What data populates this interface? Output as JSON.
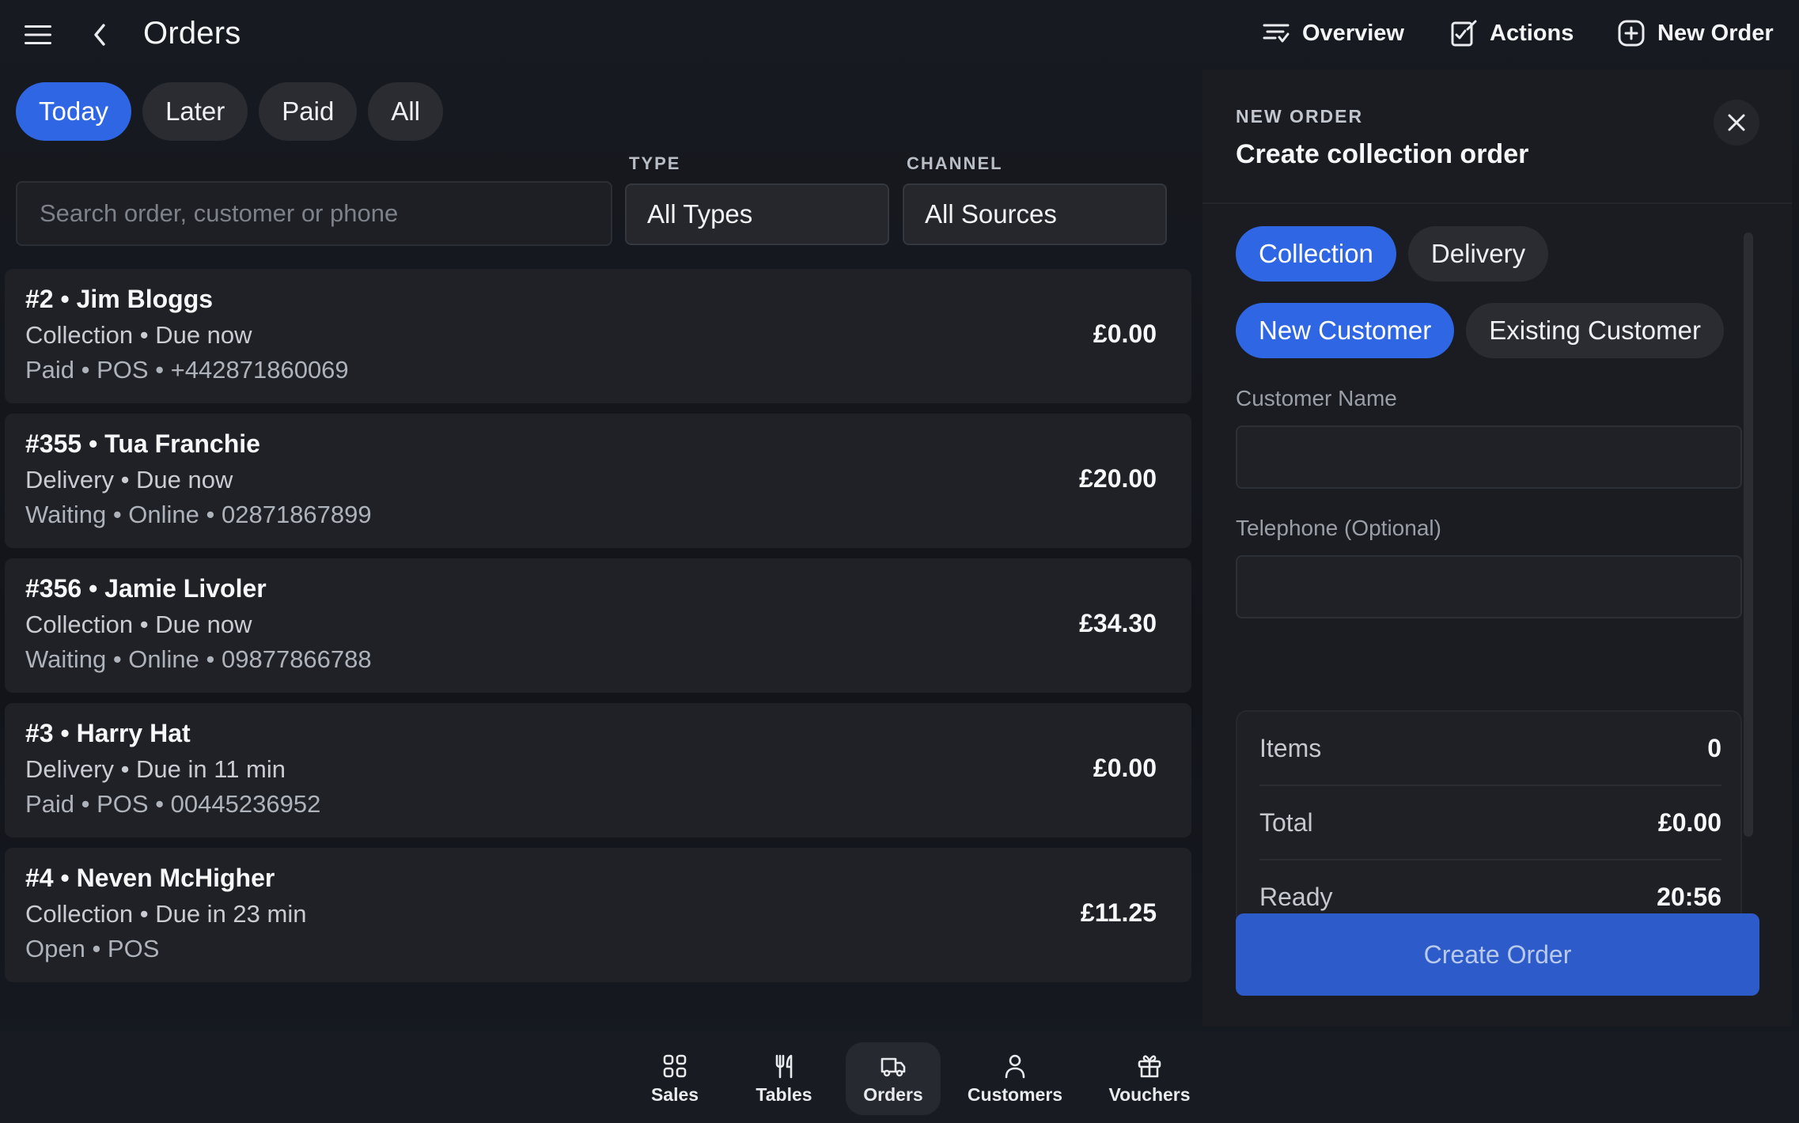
{
  "header": {
    "title": "Orders",
    "actions": [
      {
        "label": "Overview",
        "icon": "filter-list-icon"
      },
      {
        "label": "Actions",
        "icon": "edit-checklist-icon"
      },
      {
        "label": "New Order",
        "icon": "plus-circle-icon"
      }
    ]
  },
  "filters": {
    "tabs": [
      "Today",
      "Later",
      "Paid",
      "All"
    ],
    "active_tab": "Today",
    "search_placeholder": "Search order, customer or phone",
    "type_label": "TYPE",
    "type_value": "All Types",
    "channel_label": "CHANNEL",
    "channel_value": "All Sources"
  },
  "orders": [
    {
      "title": "#2 • Jim Bloggs",
      "sub": "Collection • Due now",
      "meta": "Paid • POS • +442871860069",
      "amount": "£0.00"
    },
    {
      "title": "#355 • Tua Franchie",
      "sub": "Delivery • Due now",
      "meta": "Waiting • Online • 02871867899",
      "amount": "£20.00"
    },
    {
      "title": "#356 • Jamie Livoler",
      "sub": "Collection • Due now",
      "meta": "Waiting • Online • 09877866788",
      "amount": "£34.30"
    },
    {
      "title": "#3 • Harry Hat",
      "sub": "Delivery • Due in 11 min",
      "meta": "Paid • POS • 00445236952",
      "amount": "£0.00"
    },
    {
      "title": "#4 • Neven McHigher",
      "sub": "Collection • Due in 23 min",
      "meta": "Open • POS",
      "amount": "£11.25"
    }
  ],
  "new_order": {
    "kicker": "NEW ORDER",
    "title": "Create collection order",
    "order_types": [
      "Collection",
      "Delivery"
    ],
    "active_order_type": "Collection",
    "customer_modes": [
      "New Customer",
      "Existing Customer"
    ],
    "active_customer_mode": "New Customer",
    "customer_name_label": "Customer Name",
    "customer_name_value": "",
    "telephone_label": "Telephone (Optional)",
    "telephone_value": "",
    "summary": {
      "items_label": "Items",
      "items_value": "0",
      "total_label": "Total",
      "total_value": "£0.00",
      "ready_label": "Ready",
      "ready_value": "20:56"
    },
    "create_label": "Create Order"
  },
  "bottom_nav": [
    {
      "label": "Sales",
      "icon": "grid-icon"
    },
    {
      "label": "Tables",
      "icon": "cutlery-icon"
    },
    {
      "label": "Orders",
      "icon": "delivery-truck-icon"
    },
    {
      "label": "Customers",
      "icon": "person-icon"
    },
    {
      "label": "Vouchers",
      "icon": "gift-icon"
    }
  ],
  "bottom_nav_active": "Orders",
  "colors": {
    "accent": "#2f66e3",
    "background": "#14161b",
    "card": "#1f2126",
    "pill": "#2a2c32",
    "create_button": "#2d5bc9"
  }
}
